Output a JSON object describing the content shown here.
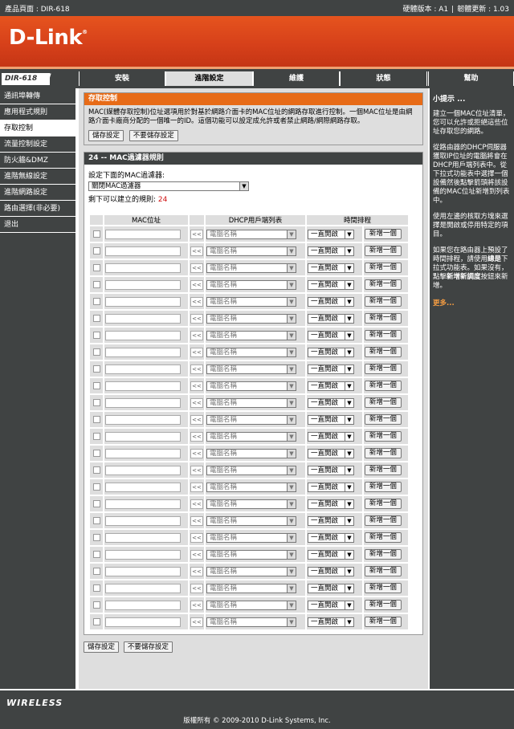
{
  "topbar": {
    "product_label": "產品頁面 : DIR-618",
    "hardware_label": "硬體版本 : A1",
    "firmware_label": "韌體更新 : 1.03"
  },
  "banner": {
    "logo_text": "D-Link",
    "logo_mark": "®"
  },
  "tabrow": {
    "model": "DIR-618",
    "tabs": [
      {
        "label": "安裝"
      },
      {
        "label": "進階設定"
      },
      {
        "label": "維護"
      },
      {
        "label": "狀態"
      },
      {
        "label": "幫助"
      }
    ]
  },
  "leftnav": {
    "items": [
      {
        "label": "通訊埠轉傳"
      },
      {
        "label": "應用程式規則"
      },
      {
        "label": "存取控制"
      },
      {
        "label": "流量控制設定"
      },
      {
        "label": "防火牆&DMZ"
      },
      {
        "label": "進階無線設定"
      },
      {
        "label": "進階網路設定"
      },
      {
        "label": "路由選擇(非必要)"
      },
      {
        "label": "退出"
      }
    ]
  },
  "intro": {
    "title": "存取控制",
    "description": "MAC(媒體存取控制)位址選項用於對基於網路介面卡的MAC位址的網路存取進行控制。一個MAC位址是由網路介面卡廠商分配的一個唯一的ID。這個功能可以設定成允許或者禁止網路/網際網路存取。",
    "save_label": "儲存設定",
    "nosave_label": "不要儲存設定"
  },
  "rules": {
    "title": "24 -- MAC過濾器規則",
    "config_label": "設定下面的MAC過濾器:",
    "filter_select": "關閉MAC過濾器",
    "remaining_label": "剩下可以建立的規則:",
    "remaining_count": "24",
    "columns": {
      "mac": "MAC位址",
      "dhcp": "DHCP用戶端列表",
      "schedule": "時間排程"
    },
    "row_defaults": {
      "copy": "<<",
      "dhcp_select": "電腦名稱",
      "schedule_select": "一直開啟",
      "add_label": "新增一個"
    },
    "row_count": 24
  },
  "bottom": {
    "save_label": "儲存設定",
    "nosave_label": "不要儲存設定"
  },
  "hints": {
    "title": "小提示 ...",
    "p1": "建立一個MAC位址清單，您可以允許或拒絕這些位址存取您的網路。",
    "p2": "從路由器的DHCP伺服器獲取IP位址的電腦將會在DHCP用戶端列表中。從下拉式功能表中選擇一個設備然後點擊箭頭將該設備的MAC位址新增到列表中。",
    "p3": "使用左邊的核取方塊來選擇是開啟或停用特定的項目。",
    "p4_a": "如果您在路由器上預設了時間排程，請使用",
    "p4_b": "總是",
    "p4_c": "下拉式功能表。如果沒有，點擊",
    "p4_d": "新增新調度",
    "p4_e": "按鈕來新增。",
    "more": "更多..."
  },
  "footer": {
    "wireless": "WIRELESS",
    "copyright": "版權所有 © 2009-2010 D-Link Systems, Inc."
  }
}
